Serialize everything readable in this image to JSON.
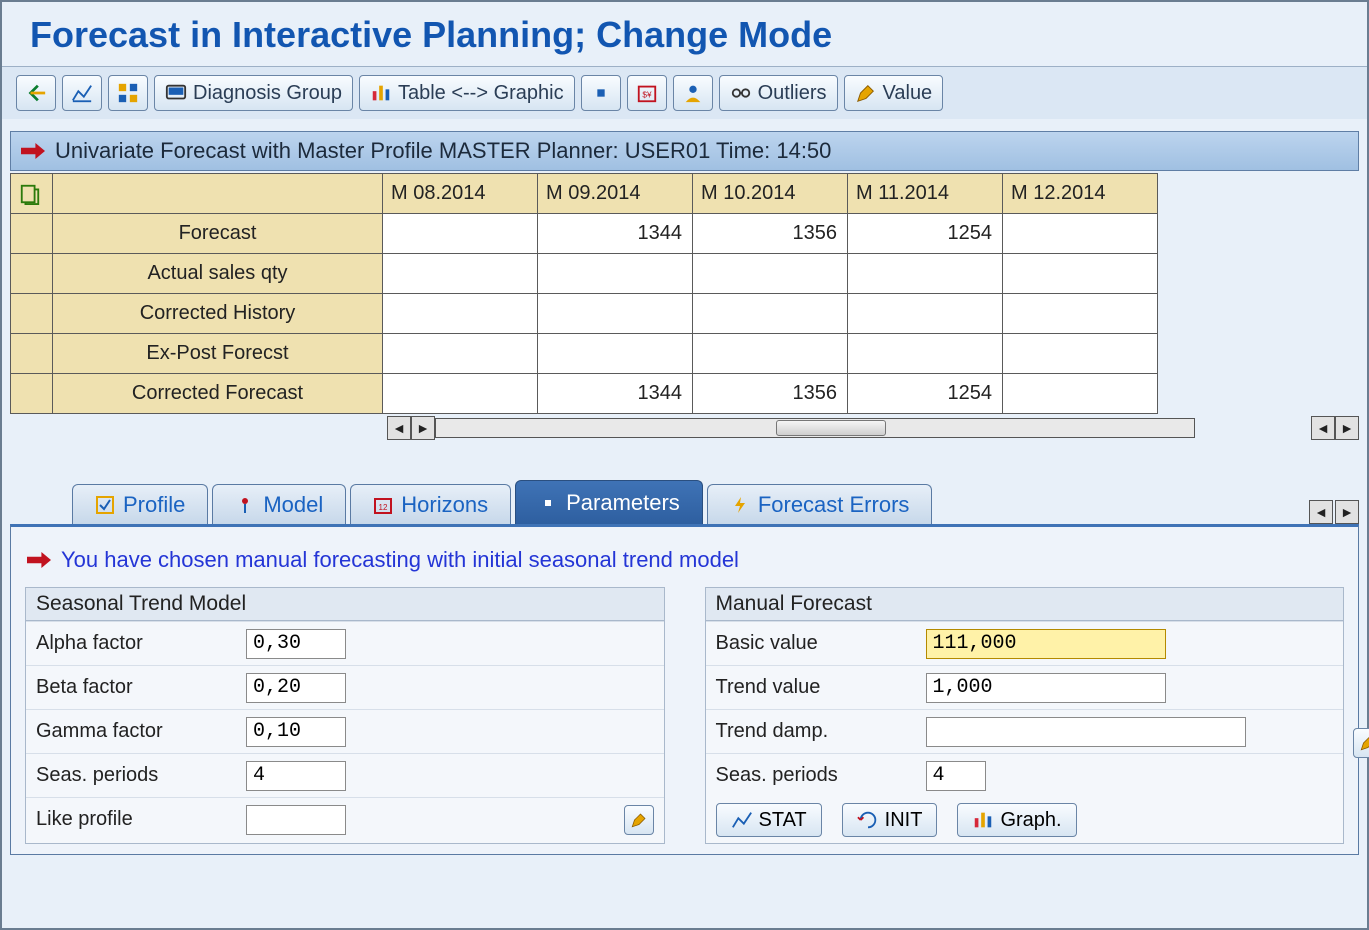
{
  "window": {
    "title": "Forecast in Interactive Planning; Change Mode"
  },
  "toolbar": {
    "diagnosis_group": "Diagnosis Group",
    "table_graphic": "Table <--> Graphic",
    "outliers": "Outliers",
    "value": "Value"
  },
  "section_bar": {
    "text": "Univariate Forecast with Master Profile MASTER Planner: USER01 Time: 14:50"
  },
  "grid": {
    "columns": [
      "M 08.2014",
      "M 09.2014",
      "M 10.2014",
      "M 11.2014",
      "M 12.2014"
    ],
    "rows": [
      {
        "label": "Forecast",
        "values": [
          "",
          "1344",
          "1356",
          "1254",
          ""
        ]
      },
      {
        "label": "Actual sales qty",
        "values": [
          "",
          "",
          "",
          "",
          ""
        ]
      },
      {
        "label": "Corrected History",
        "values": [
          "",
          "",
          "",
          "",
          ""
        ]
      },
      {
        "label": "Ex-Post Forecst",
        "values": [
          "",
          "",
          "",
          "",
          ""
        ]
      },
      {
        "label": "Corrected Forecast",
        "values": [
          "",
          "1344",
          "1356",
          "1254",
          ""
        ]
      }
    ]
  },
  "tabs": {
    "profile": "Profile",
    "model": "Model",
    "horizons": "Horizons",
    "parameters": "Parameters",
    "forecast_errors": "Forecast Errors"
  },
  "panel_message": "You have chosen manual forecasting with initial seasonal trend model",
  "seasonal_group": {
    "title": "Seasonal Trend Model",
    "alpha_label": "Alpha factor",
    "alpha_value": "0,30",
    "beta_label": "Beta factor",
    "beta_value": "0,20",
    "gamma_label": "Gamma factor",
    "gamma_value": "0,10",
    "seas_label": "Seas. periods",
    "seas_value": "4",
    "like_label": "Like profile",
    "like_value": ""
  },
  "manual_group": {
    "title": "Manual Forecast",
    "basic_label": "Basic value",
    "basic_value": "111,000",
    "trend_label": "Trend value",
    "trend_value": "1,000",
    "damp_label": "Trend damp.",
    "damp_value": "",
    "seas_label": "Seas. periods",
    "seas_value": "4",
    "stat_btn": "STAT",
    "init_btn": "INIT",
    "graph_btn": "Graph."
  }
}
